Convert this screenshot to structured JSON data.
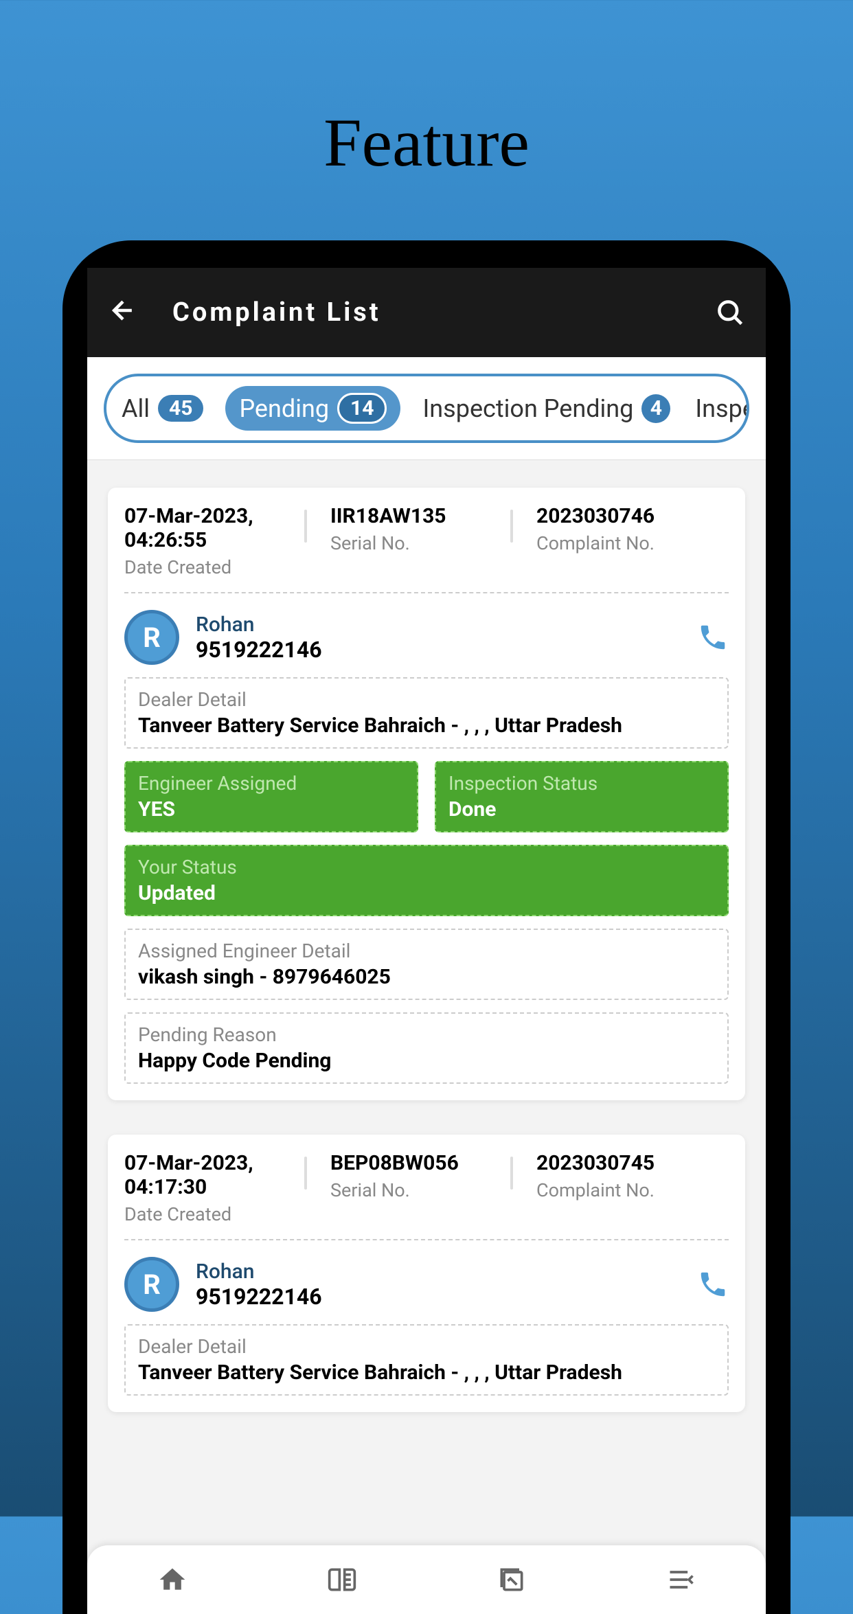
{
  "page_title": "Feature",
  "header": {
    "title": "Complaint List"
  },
  "filters": [
    {
      "label": "All",
      "count": "45",
      "active": false
    },
    {
      "label": "Pending",
      "count": "14",
      "active": true
    },
    {
      "label": "Inspection Pending",
      "count": "4",
      "active": false
    },
    {
      "label": "Inspect",
      "count": "",
      "active": false
    }
  ],
  "cards": [
    {
      "date_created": "07-Mar-2023, 04:26:55",
      "date_label": "Date Created",
      "serial_no": "IIR18AW135",
      "serial_label": "Serial No.",
      "complaint_no": "2023030746",
      "complaint_label": "Complaint No.",
      "contact": {
        "initial": "R",
        "name": "Rohan",
        "phone": "9519222146"
      },
      "dealer": {
        "label": "Dealer Detail",
        "value": "Tanveer Battery Service Bahraich - , , , Uttar Pradesh"
      },
      "engineer_assigned": {
        "label": "Engineer Assigned",
        "value": "YES"
      },
      "inspection_status": {
        "label": "Inspection Status",
        "value": "Done"
      },
      "your_status": {
        "label": "Your Status",
        "value": "Updated"
      },
      "engineer_detail": {
        "label": "Assigned Engineer Detail",
        "value": "vikash singh - 8979646025"
      },
      "pending_reason": {
        "label": "Pending Reason",
        "value": "Happy Code Pending"
      }
    },
    {
      "date_created": "07-Mar-2023, 04:17:30",
      "date_label": "Date Created",
      "serial_no": "BEP08BW056",
      "serial_label": "Serial No.",
      "complaint_no": "2023030745",
      "complaint_label": "Complaint No.",
      "contact": {
        "initial": "R",
        "name": "Rohan",
        "phone": "9519222146"
      },
      "dealer": {
        "label": "Dealer Detail",
        "value": "Tanveer Battery Service Bahraich - , , , Uttar Pradesh"
      }
    }
  ]
}
